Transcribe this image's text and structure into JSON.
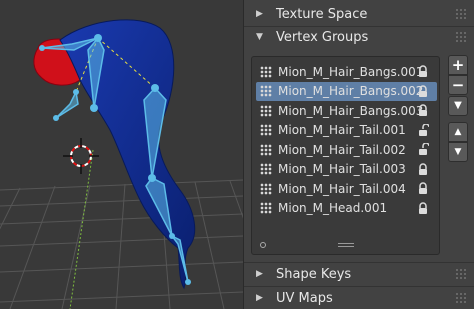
{
  "properties": {
    "sections": {
      "texture_space": "Texture Space",
      "vertex_groups": "Vertex Groups",
      "shape_keys": "Shape Keys",
      "uv_maps": "UV Maps"
    },
    "vertex_groups": [
      {
        "name": "Mion_M_Hair_Bangs.001",
        "locked": true,
        "active": false
      },
      {
        "name": "Mion_M_Hair_Bangs.002",
        "locked": true,
        "active": true
      },
      {
        "name": "Mion_M_Hair_Bangs.003",
        "locked": true,
        "active": false
      },
      {
        "name": "Mion_M_Hair_Tail.001",
        "locked": false,
        "active": false
      },
      {
        "name": "Mion_M_Hair_Tail.002",
        "locked": false,
        "active": false
      },
      {
        "name": "Mion_M_Hair_Tail.003",
        "locked": true,
        "active": false
      },
      {
        "name": "Mion_M_Hair_Tail.004",
        "locked": true,
        "active": false
      },
      {
        "name": "Mion_M_Head.001",
        "locked": true,
        "active": false
      }
    ],
    "buttons": {
      "add": "+",
      "remove": "−",
      "specials": "▼",
      "move_up": "▲",
      "move_down": "▼"
    }
  },
  "colors": {
    "mesh": "#102a8c",
    "mesh_head": "#d0101a",
    "bones": "#5cbce8",
    "active_row": "#5f7fa6"
  },
  "icons": [
    "expand-triangle-icon",
    "collapse-triangle-icon",
    "vertex-group-icon",
    "lock-closed-icon",
    "lock-open-icon",
    "3d-cursor-icon"
  ]
}
